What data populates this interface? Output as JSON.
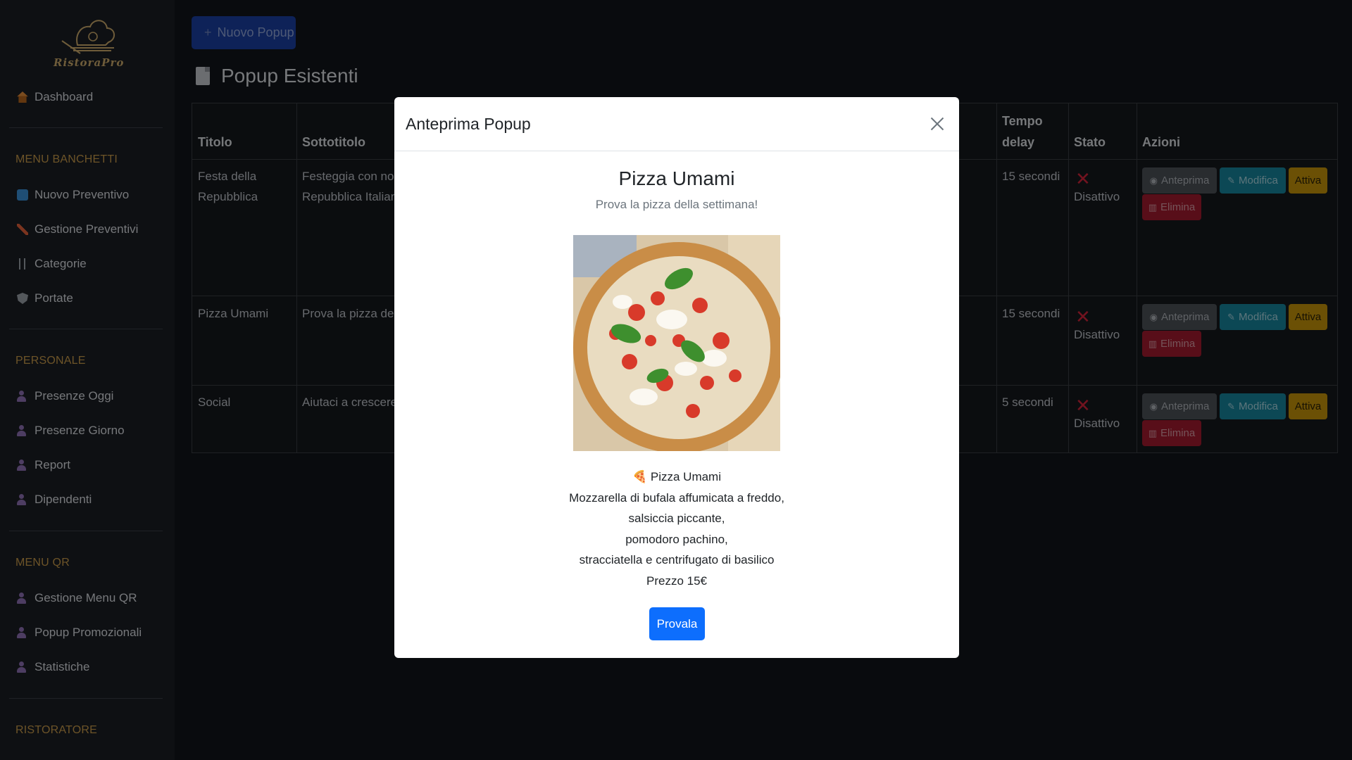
{
  "sidebar": {
    "logo_text": "RistoraPro",
    "items": {
      "dashboard": "Dashboard",
      "nuovo_preventivo": "Nuovo Preventivo",
      "gestione_preventivi": "Gestione Preventivi",
      "categorie": "Categorie",
      "portate": "Portate",
      "presenze_oggi": "Presenze Oggi",
      "presenze_giorno": "Presenze Giorno",
      "report": "Report",
      "dipendenti": "Dipendenti",
      "gestione_menu_qr": "Gestione Menu QR",
      "popup_promozionali": "Popup Promozionali",
      "statistiche": "Statistiche"
    },
    "sections": {
      "menu_banchetti": "MENU BANCHETTI",
      "personale": "PERSONALE",
      "menu_qr": "MENU QR",
      "ristoratore": "RISTORATORE"
    }
  },
  "main": {
    "new_button": "Nuovo Popup",
    "page_title": "Popup Esistenti",
    "table": {
      "headers": {
        "titolo": "Titolo",
        "sottotitolo": "Sottotitolo",
        "tempo": "Tempo",
        "delay": "delay",
        "stato": "Stato",
        "azioni": "Azioni"
      },
      "rows": [
        {
          "titolo_1": "Festa della",
          "titolo_2": "Repubblica",
          "sottotitolo_1": "Festeggia con noi l",
          "sottotitolo_2": "Repubblica Italiana",
          "delay": "15 secondi",
          "stato": "Disattivo"
        },
        {
          "titolo_1": "Pizza Umami",
          "sottotitolo_1": "Prova la pizza della",
          "delay": "15 secondi",
          "stato": "Disattivo"
        },
        {
          "titolo_1": "Social",
          "sottotitolo_1": "Aiutaci a crescere!",
          "delay": "5 secondi",
          "stato": "Disattivo"
        }
      ],
      "actions": {
        "anteprima": "Anteprima",
        "modifica": "Modifica",
        "attiva": "Attiva",
        "elimina": "Elimina"
      }
    }
  },
  "modal": {
    "title": "Anteprima Popup",
    "promo_title": "Pizza Umami",
    "promo_subtitle": "Prova la pizza della settimana!",
    "desc_line1": "🍕 Pizza Umami",
    "desc_line2": "Mozzarella di bufala affumicata a freddo,",
    "desc_line3": "salsiccia piccante,",
    "desc_line4": "pomodoro pachino,",
    "desc_line5": "stracciatella e centrifugato di basilico",
    "desc_line6": "Prezzo 15€",
    "cta": "Provala"
  },
  "colors": {
    "accent_blue": "#0d6efd",
    "section_gold": "#c79a4a",
    "status_red": "#d0233a",
    "modifica_teal": "#17849c",
    "attiva_yellow": "#c4920a",
    "elimina_red": "#a11a2e"
  }
}
